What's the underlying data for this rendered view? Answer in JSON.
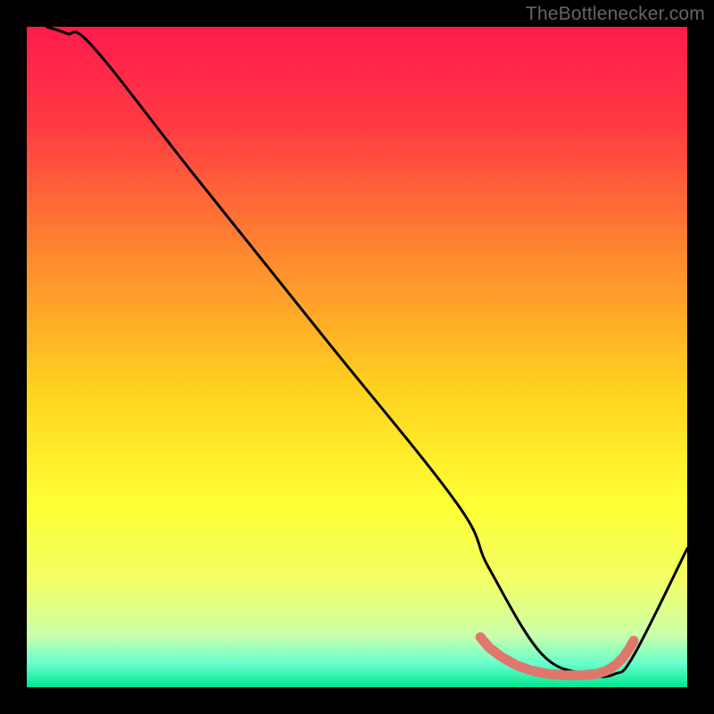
{
  "attribution": "TheBottlenecker.com",
  "chart_data": {
    "type": "line",
    "title": "",
    "xlabel": "",
    "ylabel": "",
    "xlim": [
      0,
      100
    ],
    "ylim": [
      0,
      100
    ],
    "gradient_stops": [
      {
        "offset": 0.0,
        "color": "#ff1a4d"
      },
      {
        "offset": 0.15,
        "color": "#ff3b42"
      },
      {
        "offset": 0.35,
        "color": "#ff8a2f"
      },
      {
        "offset": 0.55,
        "color": "#ffd21f"
      },
      {
        "offset": 0.72,
        "color": "#ffff33"
      },
      {
        "offset": 0.84,
        "color": "#f2ff66"
      },
      {
        "offset": 0.92,
        "color": "#ccffaa"
      },
      {
        "offset": 0.965,
        "color": "#66ffcc"
      },
      {
        "offset": 1.0,
        "color": "#00e68f"
      }
    ],
    "series": [
      {
        "name": "curve",
        "stroke": "#000000",
        "x": [
          3,
          6,
          10,
          25,
          45,
          65,
          70,
          78,
          85,
          89,
          92,
          100
        ],
        "y": [
          100,
          99,
          97,
          78,
          53,
          28,
          18,
          5,
          2,
          2,
          5,
          21
        ]
      }
    ],
    "markers": {
      "name": "dash-points",
      "color": "#e0776d",
      "x": [
        68.5,
        70,
        72,
        74.2,
        76.5,
        79,
        81.5,
        84,
        86.2,
        87.8,
        89.2,
        90.3,
        91.2,
        92.0
      ],
      "y": [
        7.8,
        6.0,
        4.5,
        3.3,
        2.5,
        2.0,
        1.8,
        1.8,
        2.0,
        2.5,
        3.4,
        4.5,
        5.8,
        7.2
      ]
    }
  }
}
